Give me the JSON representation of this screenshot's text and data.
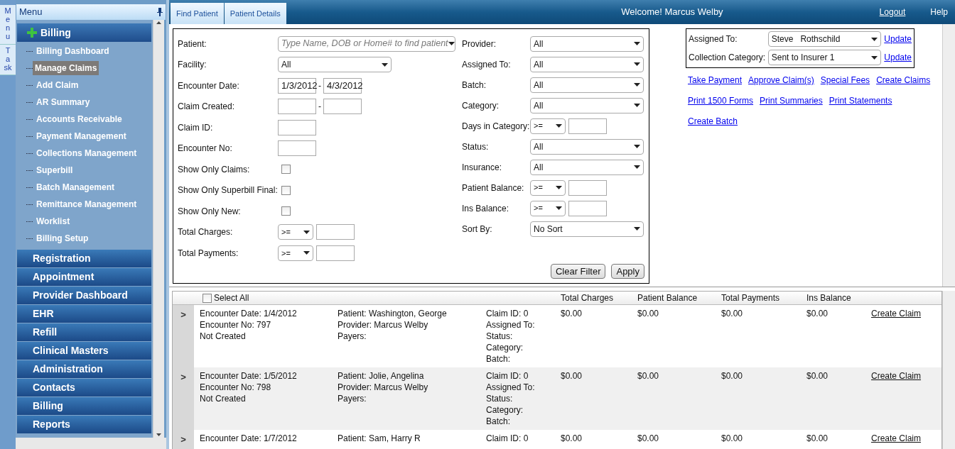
{
  "side_tabs": [
    "Menu",
    "Task"
  ],
  "sidebar": {
    "title": "Menu",
    "section": {
      "label": "Billing",
      "expanded": true,
      "items": [
        {
          "label": "Billing Dashboard",
          "selected": false
        },
        {
          "label": "Manage Claims",
          "selected": true
        },
        {
          "label": "Add Claim",
          "selected": false
        },
        {
          "label": "AR Summary",
          "selected": false
        },
        {
          "label": "Accounts Receivable",
          "selected": false
        },
        {
          "label": "Payment Management",
          "selected": false
        },
        {
          "label": "Collections Management",
          "selected": false
        },
        {
          "label": "Superbill",
          "selected": false
        },
        {
          "label": "Batch Management",
          "selected": false
        },
        {
          "label": "Remittance Management",
          "selected": false
        },
        {
          "label": "Worklist",
          "selected": false
        },
        {
          "label": "Billing Setup",
          "selected": false
        }
      ]
    },
    "modules": [
      "Registration",
      "Appointment",
      "Provider Dashboard",
      "EHR",
      "Refill",
      "Clinical Masters",
      "Administration",
      "Contacts",
      "Billing",
      "Reports"
    ]
  },
  "header": {
    "tabs": [
      "Find Patient",
      "Patient Details"
    ],
    "welcome": "Welcome! Marcus Welby",
    "links": [
      "Logout",
      "Help"
    ]
  },
  "filters": {
    "left": [
      {
        "label": "Patient:",
        "kind": "combo",
        "placeholder": "Type Name, DOB or Home# to find patient"
      },
      {
        "label": "Facility:",
        "kind": "select",
        "value": "All"
      },
      {
        "label": "Encounter Date:",
        "kind": "range",
        "from": "1/3/2012",
        "to": "4/3/2012",
        "separator": "-"
      },
      {
        "label": "Claim Created:",
        "kind": "range",
        "separator": "-"
      },
      {
        "label": "Claim ID:",
        "kind": "text"
      },
      {
        "label": "Encounter No:",
        "kind": "text"
      },
      {
        "label": "Show Only Claims:",
        "kind": "checkbox",
        "checked": false
      },
      {
        "label": "Show Only Superbill Final:",
        "kind": "checkbox",
        "checked": false
      },
      {
        "label": "Show Only New:",
        "kind": "checkbox",
        "checked": false
      },
      {
        "label": "Total Charges:",
        "kind": "compare",
        "op": ">="
      },
      {
        "label": "Total Payments:",
        "kind": "compare",
        "op": ">="
      }
    ],
    "right": [
      {
        "label": "Provider:",
        "kind": "select",
        "value": "All"
      },
      {
        "label": "Assigned To:",
        "kind": "select",
        "value": "All"
      },
      {
        "label": "Batch:",
        "kind": "select",
        "value": "All"
      },
      {
        "label": "Category:",
        "kind": "select",
        "value": "All"
      },
      {
        "label": "Days in Category:",
        "kind": "compare",
        "op": ">="
      },
      {
        "label": "Status:",
        "kind": "select",
        "value": "All"
      },
      {
        "label": "Insurance:",
        "kind": "select",
        "value": "All"
      },
      {
        "label": "Patient Balance:",
        "kind": "compare",
        "op": ">="
      },
      {
        "label": "Ins Balance:",
        "kind": "compare",
        "op": ">="
      },
      {
        "label": "Sort By:",
        "kind": "select",
        "value": "No Sort"
      }
    ],
    "buttons": [
      "Clear Filter",
      "Apply"
    ]
  },
  "actions": {
    "assign": [
      {
        "label": "Assigned To:",
        "value": "Steve   Rothschild",
        "link": "Update"
      },
      {
        "label": "Collection Category:",
        "value": "Sent to Insurer 1",
        "link": "Update"
      }
    ],
    "links": [
      [
        "Take Payment",
        "Approve Claim(s)",
        "Special Fees",
        "Create Claims"
      ],
      [
        "Print 1500 Forms",
        "Print Summaries",
        "Print Statements"
      ],
      [
        "Create Batch"
      ]
    ]
  },
  "grid": {
    "select_all": {
      "label": "Select All",
      "checked": false
    },
    "columns": [
      "Total Charges",
      "Patient Balance",
      "Total Payments",
      "Ins Balance"
    ],
    "rows": [
      {
        "expander": ">",
        "encounter": [
          "Encounter Date: 1/4/2012",
          "Encounter No: 797",
          "Not Created"
        ],
        "patient": [
          "Patient: Washington, George",
          "Provider: Marcus Welby",
          "Payers:"
        ],
        "claim": [
          "Claim ID: 0",
          "Assigned To:",
          "Status:",
          "Category:",
          "Batch:"
        ],
        "amounts": [
          "$0.00",
          "$0.00",
          "$0.00",
          "$0.00"
        ],
        "action": "Create Claim"
      },
      {
        "expander": ">",
        "encounter": [
          "Encounter Date: 1/5/2012",
          "Encounter No: 798",
          "Not Created"
        ],
        "patient": [
          "Patient: Jolie, Angelina",
          "Provider: Marcus Welby",
          "Payers:"
        ],
        "claim": [
          "Claim ID: 0",
          "Assigned To:",
          "Status:",
          "Category:",
          "Batch:"
        ],
        "amounts": [
          "$0.00",
          "$0.00",
          "$0.00",
          "$0.00"
        ],
        "action": "Create Claim"
      },
      {
        "expander": ">",
        "encounter": [
          "Encounter Date: 1/7/2012"
        ],
        "patient": [
          "Patient: Sam, Harry R"
        ],
        "claim": [
          "Claim ID: 0"
        ],
        "amounts": [
          "$0.00",
          "$0.00",
          "$0.00",
          "$0.00"
        ],
        "action": "Create Claim"
      }
    ]
  }
}
